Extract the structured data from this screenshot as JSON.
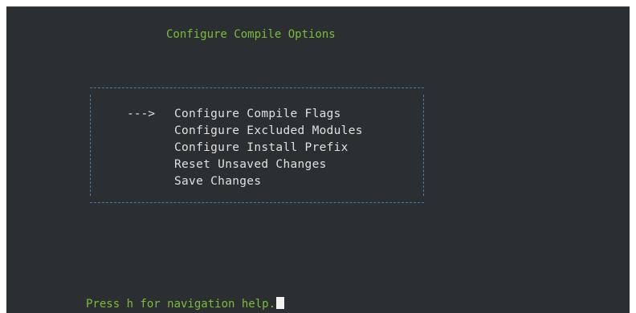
{
  "screen": {
    "title": "Configure Compile Options",
    "status_message": "Press h for navigation help."
  },
  "menu": {
    "selection_marker": "--->",
    "selected_index": 0,
    "items": [
      {
        "label": "Configure Compile Flags"
      },
      {
        "label": "Configure Excluded Modules"
      },
      {
        "label": "Configure Install Prefix"
      },
      {
        "label": "Reset Unsaved Changes"
      },
      {
        "label": "Save Changes"
      }
    ]
  },
  "colors": {
    "background": "#2b2f31",
    "accent_green": "#7dbb3c",
    "menu_text": "#e0e0e0",
    "box_border": "#4d78a8",
    "cursor": "#f2f2f2"
  }
}
